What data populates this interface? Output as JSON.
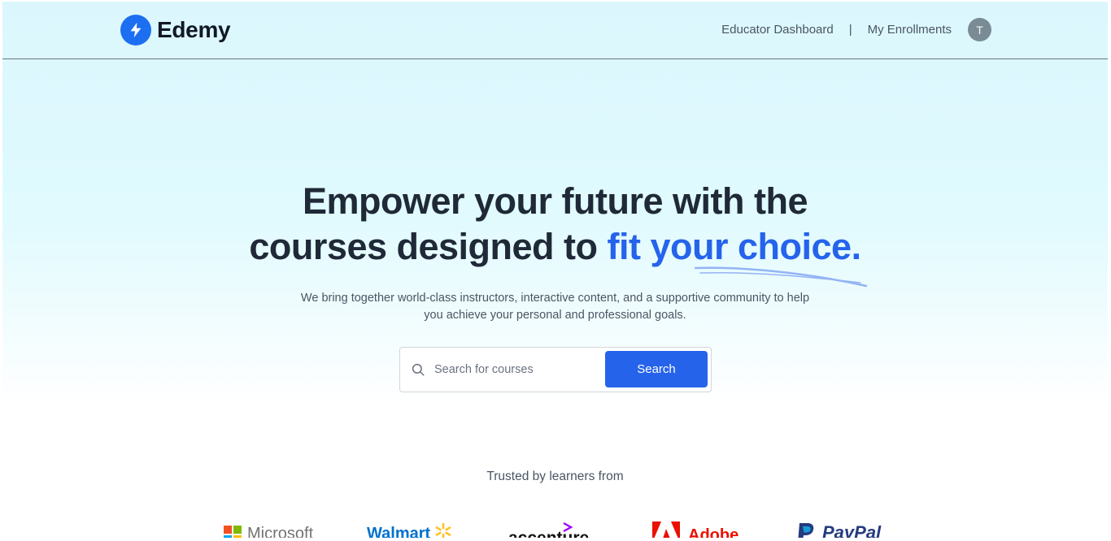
{
  "header": {
    "logo_text": "Edemy",
    "nav": {
      "educator_dashboard": "Educator Dashboard",
      "separator": "|",
      "my_enrollments": "My Enrollments"
    },
    "avatar_initial": "T"
  },
  "hero": {
    "title_line1": "Empower your future with the",
    "title_line2_prefix": "courses designed to ",
    "title_line2_accent": "fit your choice.",
    "subtitle_line1": "We bring together world-class instructors, interactive content, and a supportive community to help",
    "subtitle_line2": "you achieve your personal and professional goals."
  },
  "search": {
    "placeholder": "Search for courses",
    "button_label": "Search"
  },
  "trusted": {
    "label": "Trusted by learners from",
    "companies": [
      "Microsoft",
      "Walmart",
      "accenture",
      "Adobe",
      "PayPal"
    ]
  },
  "colors": {
    "accent": "#2563eb",
    "logo_blue": "#1d6ff2",
    "hero_bg": "#e0fafe"
  }
}
